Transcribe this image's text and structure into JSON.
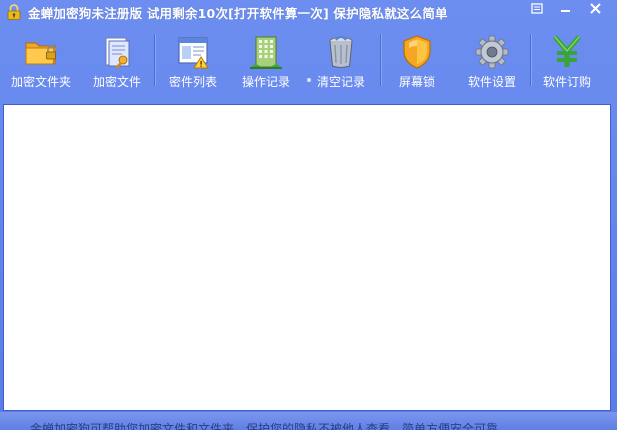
{
  "window": {
    "title": "金蝉加密狗未注册版 试用剩余10次[打开软件算一次] 保护隐私就这么简单"
  },
  "toolbar": {
    "items": [
      {
        "label": "加密文件夹",
        "icon": "folder-lock-icon"
      },
      {
        "label": "加密文件",
        "icon": "file-lock-icon"
      },
      {
        "label": "密件列表",
        "icon": "list-warning-icon"
      },
      {
        "label": "操作记录",
        "icon": "building-icon"
      },
      {
        "label": "清空记录",
        "icon": "trash-can-icon"
      },
      {
        "label": "屏幕锁",
        "icon": "shield-icon"
      },
      {
        "label": "软件设置",
        "icon": "gear-icon"
      },
      {
        "label": "软件订购",
        "icon": "yen-icon"
      }
    ]
  },
  "status": {
    "text": "金蝉加密狗可帮助您加密文件和文件夹，保护您的隐私不被他人查看，简单方便安全可靠"
  },
  "colors": {
    "window_bg": "#6d8ef0",
    "content_bg": "#ffffff",
    "border": "#3e5fcf"
  }
}
